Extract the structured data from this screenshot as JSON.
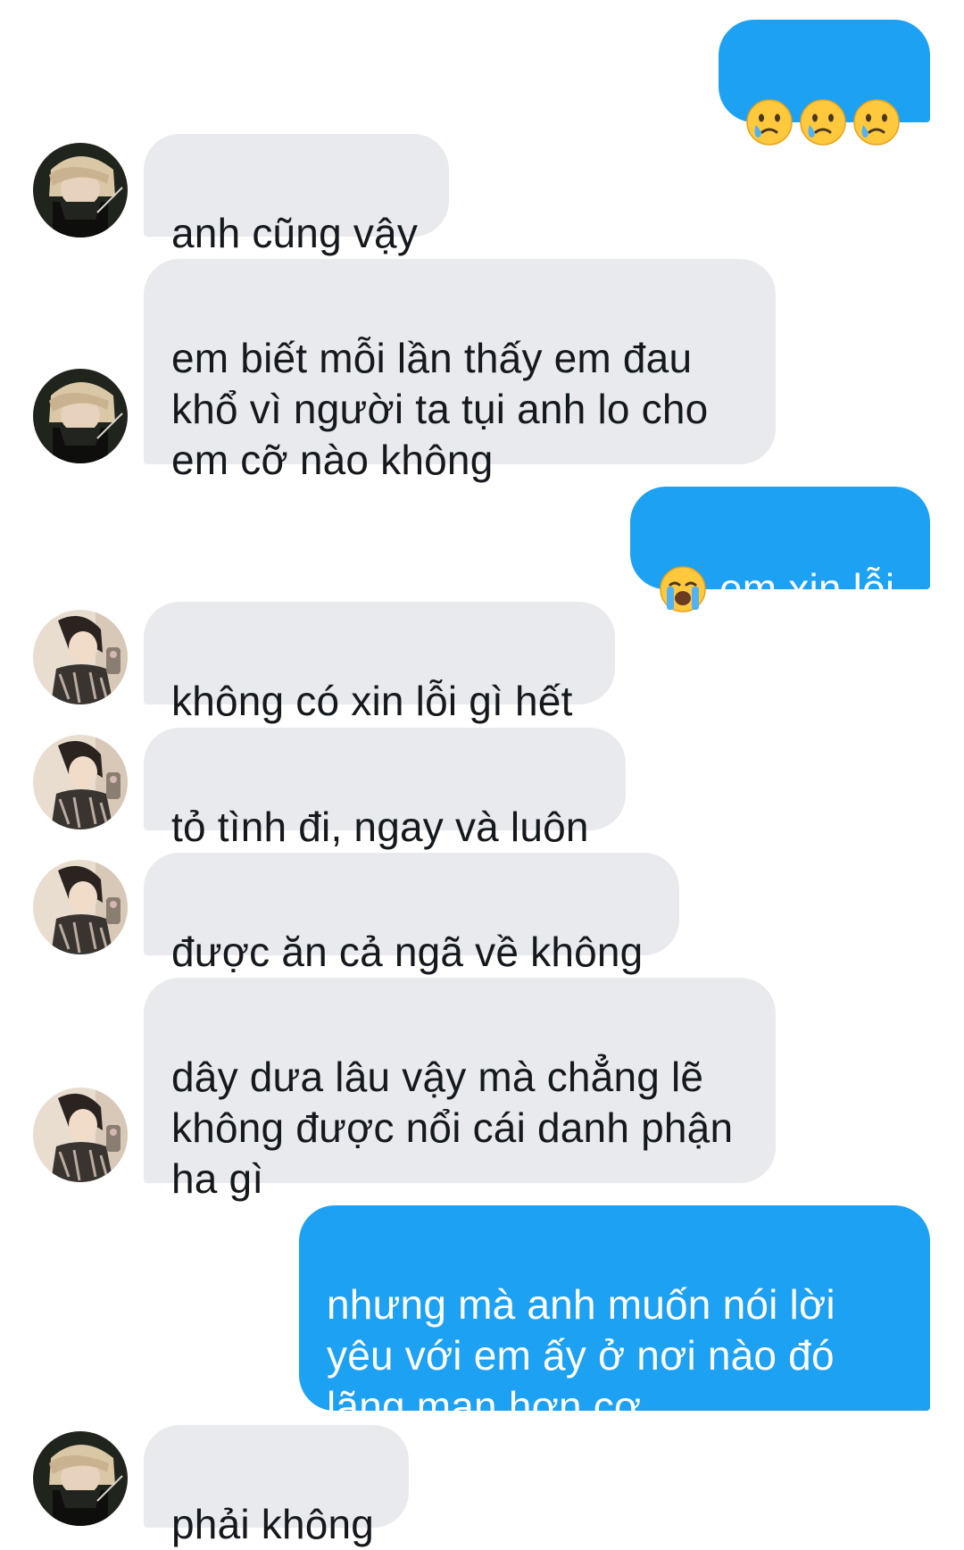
{
  "colors": {
    "incoming_bubble": "#e8eaee",
    "outgoing_bubble": "#1da1f2",
    "incoming_text": "#15181c",
    "outgoing_text": "#ffffff"
  },
  "messages": [
    {
      "id": 1,
      "direction": "outgoing",
      "emojis": [
        "crying-face",
        "crying-face",
        "crying-face"
      ],
      "text": ""
    },
    {
      "id": 2,
      "direction": "incoming",
      "avatar": "avatar-masked",
      "text": "anh cũng vậy"
    },
    {
      "id": 3,
      "direction": "incoming",
      "avatar": "avatar-masked",
      "text": "em biết mỗi lần thấy em đau\nkhổ vì người ta tụi anh lo cho\nem cỡ nào không"
    },
    {
      "id": 4,
      "direction": "outgoing",
      "emojis": [
        "loudly-crying-face"
      ],
      "text": "em xin lỗi"
    },
    {
      "id": 5,
      "direction": "incoming",
      "avatar": "avatar-mirror-selfie",
      "text": "không có xin lỗi gì hết"
    },
    {
      "id": 6,
      "direction": "incoming",
      "avatar": "avatar-mirror-selfie",
      "text": "tỏ tình đi, ngay và luôn"
    },
    {
      "id": 7,
      "direction": "incoming",
      "avatar": "avatar-mirror-selfie",
      "text": "được ăn cả ngã về không"
    },
    {
      "id": 8,
      "direction": "incoming",
      "avatar": "avatar-mirror-selfie",
      "text": "dây dưa lâu vậy mà chẳng lẽ\nkhông được nổi cái danh phận\nha gì"
    },
    {
      "id": 9,
      "direction": "outgoing",
      "text": "nhưng mà anh muốn nói lời\nyêu với em ấy ở nơi nào đó\nlãng mạn hơn cơ..."
    },
    {
      "id": 10,
      "direction": "incoming",
      "avatar": "avatar-masked",
      "text": "phải không"
    }
  ]
}
